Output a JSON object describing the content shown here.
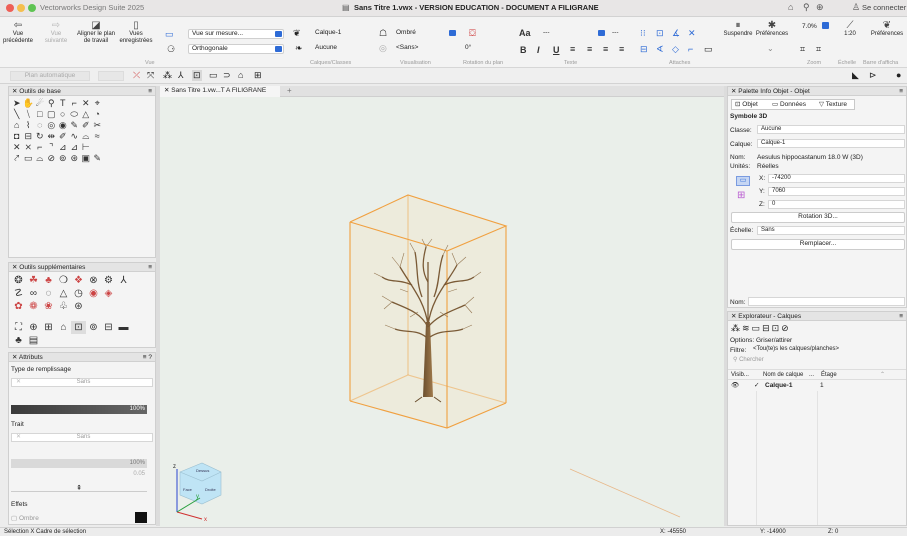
{
  "titlebar": {
    "app_name": "Vectorworks Design Suite 2025",
    "doc_title": "Sans Titre 1.vwx - VERSION EDUCATION - DOCUMENT A FILIGRANE",
    "connect": "Se connecter"
  },
  "toolbar": {
    "prev_view": "Vue\nprécédente",
    "next_view": "Vue\nsuivante",
    "align_plane": "Aligner le plan\nde travail",
    "saved_views": "Vues\nenregistrées",
    "view_dropdown": "Vue sur mesure...",
    "projection_dropdown": "Orthogonale",
    "layer_dropdown": "Calque-1",
    "class_dropdown": "Aucune",
    "render_dropdown": "Ombré",
    "render_style_dropdown": "<Sans>",
    "rotation_value": "0°",
    "text_size": "---",
    "line_value": "---",
    "suspend": "Suspendre",
    "preferences": "Préférences",
    "zoom_value": "7.0%",
    "scale_value": "1:20",
    "prefs_right": "Préférences",
    "group_vue": "Vue",
    "group_calques": "Calques/Classes",
    "group_visu": "Visualisation",
    "group_rotation": "Rotation du plan",
    "group_texte": "Texte",
    "group_attaches": "Attaches",
    "group_zoom": "Zoom",
    "group_echelle": "Échelle",
    "group_barre": "Barre d'afficha",
    "text_bold": "B",
    "text_italic": "I",
    "text_underline": "U",
    "text_menu": "Aa"
  },
  "modebar": {
    "auto_plane": "Plan automatique"
  },
  "tools_base": {
    "title": "Outils de base"
  },
  "tools_supp": {
    "title": "Outils supplémentaires"
  },
  "attributes": {
    "title": "Attributs",
    "fill_type": "Type de remplissage",
    "fill_value": "Sans",
    "opacity": "100%",
    "stroke": "Trait",
    "stroke_value": "Sans",
    "stroke_width": "100%",
    "stroke_size": "0.05",
    "effects": "Effets",
    "shadow": "Ombre"
  },
  "tab": {
    "label": "Sans Titre 1.vw...T A FILIGRANE",
    "add": "+"
  },
  "info_palette": {
    "title": "Palette Info Objet - Objet",
    "tab_object": "Objet",
    "tab_data": "Données",
    "tab_texture": "Texture",
    "obj_type": "Symbole 3D",
    "class_label": "Classe:",
    "class_value": "Aucune",
    "layer_label": "Calque:",
    "layer_value": "Calque-1",
    "name_label": "Nom:",
    "name_value": "Aesulus hippocastanum 18.0 W (3D)",
    "units_label": "Unités:",
    "units_value": "Réelles",
    "x_label": "X:",
    "x_value": "-74200",
    "y_label": "Y:",
    "y_value": "7060",
    "z_label": "Z:",
    "z_value": "0",
    "rotation_btn": "Rotation 3D...",
    "scale_label": "Échelle:",
    "scale_value": "Sans",
    "replace_btn": "Remplacer...",
    "nom_label": "Nom:"
  },
  "layers": {
    "title": "Explorateur - Calques",
    "options_label": "Options:",
    "options_value": "Griser/attirer",
    "filter_label": "Filtre:",
    "filter_value": "<Tou(te)s les calques/planches>",
    "search_placeholder": "Chercher",
    "col_visib": "Visib...",
    "col_name": "Nom de calque",
    "col_dots": "...",
    "col_stage": "Étage",
    "row_name": "Calque-1",
    "row_num": "1"
  },
  "status": {
    "left": "Sélection  X  Cadre de sélection",
    "x": "X: -45550",
    "y": "Y: -14900",
    "z": "Z: 0"
  },
  "cube": {
    "top": "Dessus",
    "left": "Face",
    "right": "Droite"
  },
  "axes": {
    "z": "z",
    "x": "x",
    "y": "y"
  }
}
